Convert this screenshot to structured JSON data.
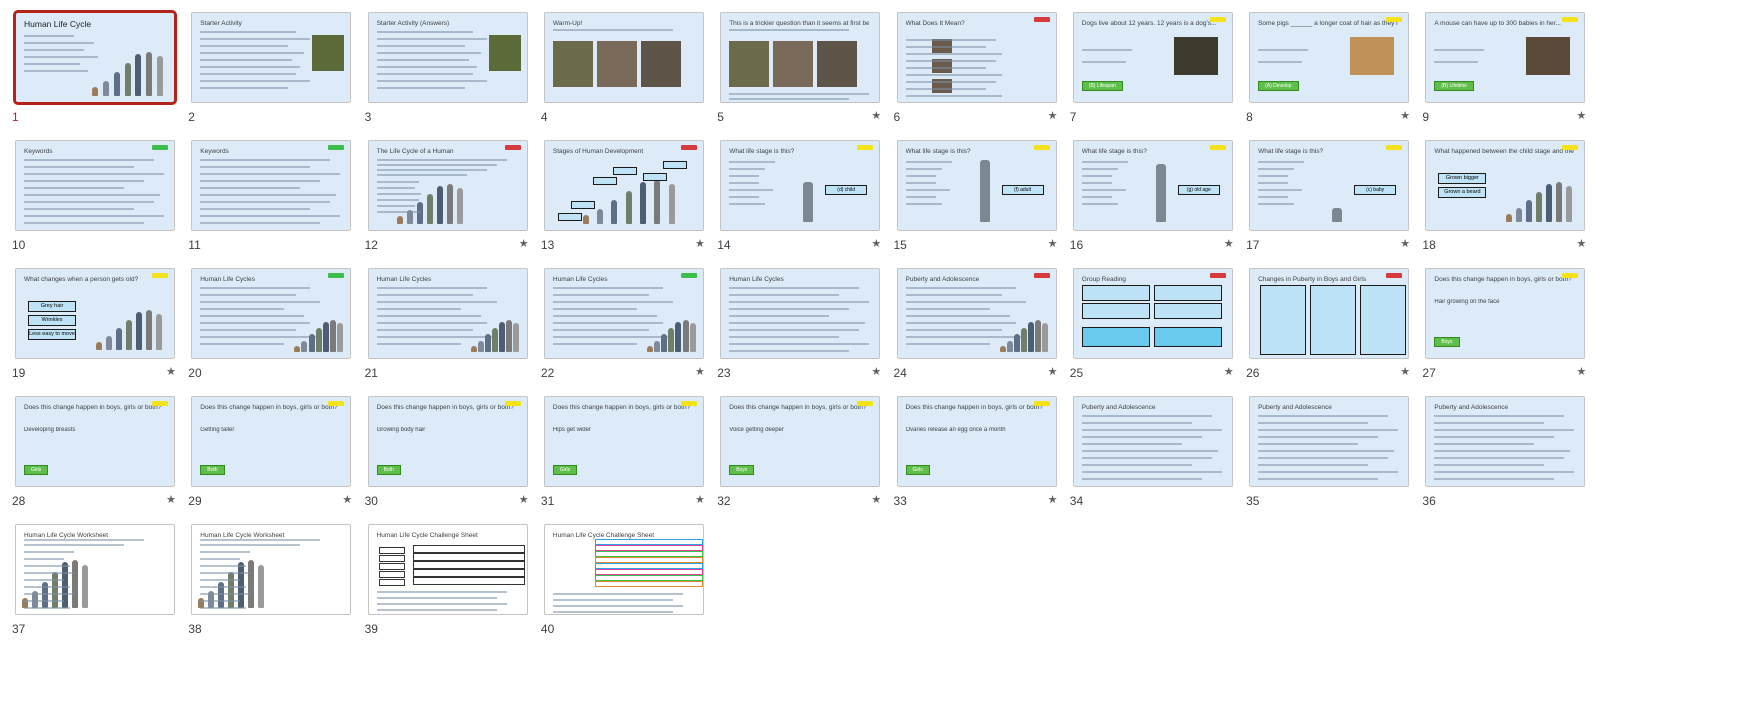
{
  "slides": [
    {
      "n": "1",
      "title": "Human Life Cycle",
      "big": true,
      "selected": true,
      "star": false,
      "kind": "people"
    },
    {
      "n": "2",
      "title": "Starter Activity",
      "star": false,
      "kind": "text-photo"
    },
    {
      "n": "3",
      "title": "Starter Activity (Answers)",
      "star": false,
      "kind": "text-photo"
    },
    {
      "n": "4",
      "title": "Warm-Up!",
      "star": false,
      "kind": "photos3"
    },
    {
      "n": "5",
      "title": "This is a trickier question than it seems at first because different species grow at different speeds!",
      "star": true,
      "kind": "photos3"
    },
    {
      "n": "6",
      "title": "What Does It Mean?",
      "star": true,
      "tag": "red",
      "kind": "rows"
    },
    {
      "n": "7",
      "title": "Dogs live about 12 years. 12 years is a dog's...",
      "star": false,
      "tag": "yellow",
      "answer": "(B) Lifespan",
      "kind": "question-photo"
    },
    {
      "n": "8",
      "title": "Some pigs ______ a longer coat of hair as they mature.",
      "star": true,
      "tag": "yellow",
      "answer": "(A) Develop",
      "kind": "question-photo"
    },
    {
      "n": "9",
      "title": "A mouse can have up to 300 babies in her...",
      "star": true,
      "tag": "yellow",
      "answer": "(B) Lifetime",
      "kind": "question-photo"
    },
    {
      "n": "10",
      "title": "Keywords",
      "star": false,
      "tag": "green",
      "kind": "text"
    },
    {
      "n": "11",
      "title": "Keywords",
      "star": false,
      "tag": "green",
      "kind": "text"
    },
    {
      "n": "12",
      "title": "The Life Cycle of a Human",
      "star": true,
      "tag": "red",
      "kind": "people-text"
    },
    {
      "n": "13",
      "title": "Stages of Human Development",
      "star": true,
      "tag": "red",
      "kind": "people-labels"
    },
    {
      "n": "14",
      "title": "What life stage is this?",
      "star": true,
      "tag": "yellow",
      "answer": "(d) child",
      "kind": "stage"
    },
    {
      "n": "15",
      "title": "What life stage is this?",
      "star": true,
      "tag": "yellow",
      "answer": "(f) adult",
      "kind": "stage"
    },
    {
      "n": "16",
      "title": "What life stage is this?",
      "star": true,
      "tag": "yellow",
      "answer": "(g) old age",
      "kind": "stage"
    },
    {
      "n": "17",
      "title": "What life stage is this?",
      "star": true,
      "tag": "yellow",
      "answer": "(c) baby",
      "kind": "stage"
    },
    {
      "n": "18",
      "title": "What happened between the child stage and the adult stage?",
      "star": true,
      "tag": "yellow",
      "kind": "boxes-people",
      "boxes": [
        "Grown bigger",
        "Grown a beard"
      ]
    },
    {
      "n": "19",
      "title": "What changes when a person gets old?",
      "star": true,
      "tag": "yellow",
      "kind": "boxes-people",
      "boxes": [
        "Grey hair",
        "Wrinkles",
        "Less easy to move"
      ]
    },
    {
      "n": "20",
      "title": "Human Life Cycles",
      "star": false,
      "tag": "green",
      "kind": "text-people"
    },
    {
      "n": "21",
      "title": "Human Life Cycles",
      "star": false,
      "kind": "text-people"
    },
    {
      "n": "22",
      "title": "Human Life Cycles",
      "star": true,
      "tag": "green",
      "kind": "text-people"
    },
    {
      "n": "23",
      "title": "Human Life Cycles",
      "star": true,
      "kind": "text"
    },
    {
      "n": "24",
      "title": "Puberty and Adolescence",
      "star": true,
      "tag": "red",
      "kind": "text-people"
    },
    {
      "n": "25",
      "title": "Group Reading",
      "star": true,
      "tag": "red",
      "kind": "reading"
    },
    {
      "n": "26",
      "title": "Changes in Puberty in Boys and Girls",
      "star": true,
      "tag": "red",
      "kind": "three-col"
    },
    {
      "n": "27",
      "title": "Does this change happen in boys, girls or both?",
      "star": true,
      "tag": "yellow",
      "sub": "Hair growing on the face",
      "answer": "Boys",
      "kind": "change"
    },
    {
      "n": "28",
      "title": "Does this change happen in boys, girls or both?",
      "star": true,
      "tag": "yellow",
      "sub": "Developing breasts",
      "answer": "Girls",
      "kind": "change"
    },
    {
      "n": "29",
      "title": "Does this change happen in boys, girls or both?",
      "star": true,
      "tag": "yellow",
      "sub": "Getting taller",
      "answer": "Both",
      "kind": "change"
    },
    {
      "n": "30",
      "title": "Does this change happen in boys, girls or both?",
      "star": true,
      "tag": "yellow",
      "sub": "Growing body hair",
      "answer": "Both",
      "kind": "change"
    },
    {
      "n": "31",
      "title": "Does this change happen in boys, girls or both?",
      "star": true,
      "tag": "yellow",
      "sub": "Hips get wider",
      "answer": "Girls",
      "kind": "change"
    },
    {
      "n": "32",
      "title": "Does this change happen in boys, girls or both?",
      "star": true,
      "tag": "yellow",
      "sub": "Voice getting deeper",
      "answer": "Boys",
      "kind": "change"
    },
    {
      "n": "33",
      "title": "Does this change happen in boys, girls or both?",
      "star": true,
      "tag": "yellow",
      "sub": "Ovaries release an egg once a month",
      "answer": "Girls",
      "kind": "change"
    },
    {
      "n": "34",
      "title": "Puberty and Adolescence",
      "star": false,
      "kind": "text"
    },
    {
      "n": "35",
      "title": "Puberty and Adolescence",
      "star": false,
      "kind": "text"
    },
    {
      "n": "36",
      "title": "Puberty and Adolescence",
      "star": false,
      "kind": "text"
    },
    {
      "n": "37",
      "title": "Human Life Cycle Worksheet",
      "star": false,
      "white": true,
      "kind": "worksheet-people"
    },
    {
      "n": "38",
      "title": "Human Life Cycle Worksheet",
      "star": false,
      "white": true,
      "kind": "worksheet-people"
    },
    {
      "n": "39",
      "title": "Human Life Cycle Challenge Sheet",
      "star": false,
      "white": true,
      "kind": "worksheet-table"
    },
    {
      "n": "40",
      "title": "Human Life Cycle Challenge Sheet",
      "star": false,
      "white": true,
      "kind": "worksheet-lines"
    }
  ],
  "colors": {
    "green": "#3bbf4a",
    "yellow": "#f4e21a",
    "red": "#d63a3a",
    "slide_bg": "#ddebf8",
    "selected_border": "#b42318"
  },
  "icons": {
    "star": "star-icon"
  }
}
